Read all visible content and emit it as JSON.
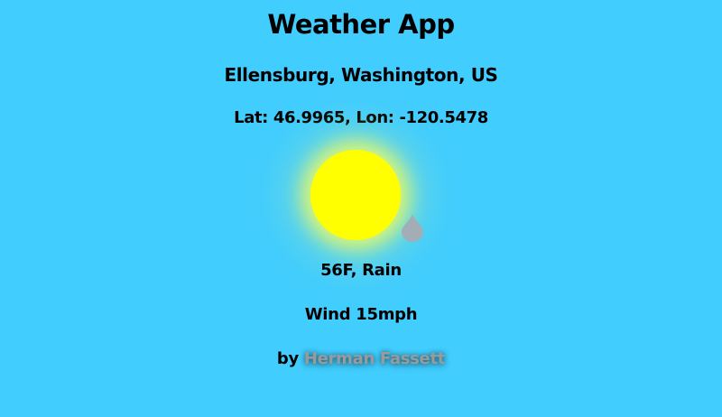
{
  "app": {
    "title": "Weather App"
  },
  "location": {
    "name": "Ellensburg, Washington, US",
    "coordinates": "Lat: 46.9965, Lon: -120.5478"
  },
  "weather": {
    "icon": "sun-icon",
    "precipitation_icon": "raindrop-icon",
    "conditions": "56F, Rain",
    "wind": "Wind 15mph"
  },
  "credit": {
    "prefix": "by",
    "author": "Herman Fassett"
  },
  "colors": {
    "background": "#41cdfe",
    "sun": "#ffff00",
    "raindrop": "#a3adb5",
    "author_text": "#9a9a9a"
  }
}
